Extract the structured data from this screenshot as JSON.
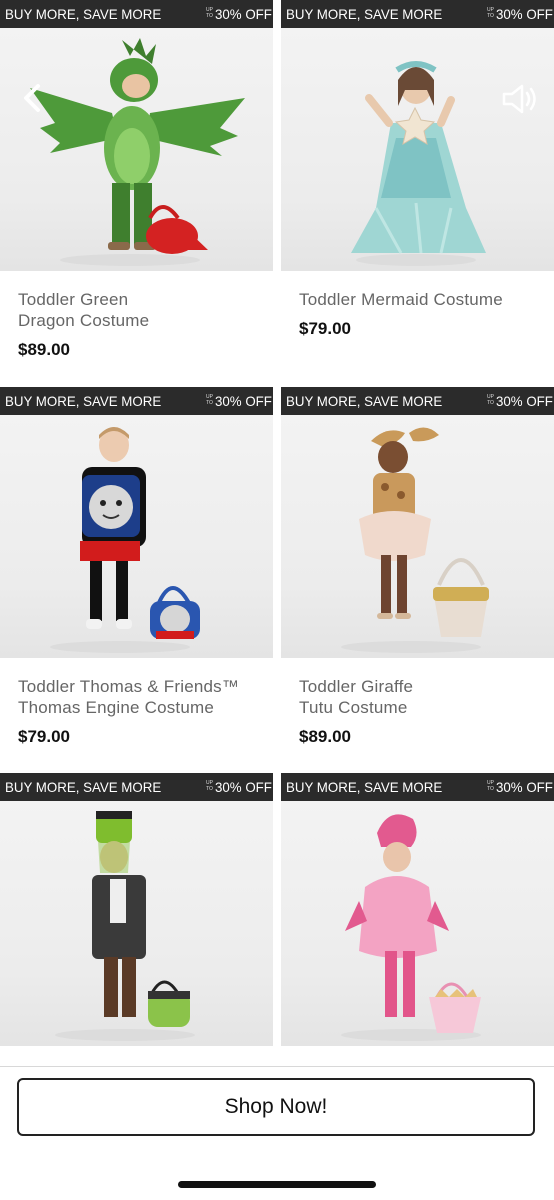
{
  "products": [
    {
      "promo": "BUY MORE, SAVE MORE",
      "upto": "UP\nTO",
      "discount": "30% OFF",
      "name": "Toddler Green\nDragon Costume",
      "price": "$89.00",
      "image_icon": "dragon-costume-photo"
    },
    {
      "promo": "BUY MORE, SAVE MORE",
      "upto": "UP\nTO",
      "discount": "30% OFF",
      "name": "Toddler Mermaid Costume",
      "price": "$79.00",
      "image_icon": "mermaid-costume-photo"
    },
    {
      "promo": "BUY MORE, SAVE MORE",
      "upto": "UP\nTO",
      "discount": "30% OFF",
      "name": "Toddler Thomas & Friends™\nThomas Engine Costume",
      "price": "$79.00",
      "image_icon": "thomas-costume-photo"
    },
    {
      "promo": "BUY MORE, SAVE MORE",
      "upto": "UP\nTO",
      "discount": "30% OFF",
      "name": "Toddler Giraffe\nTutu Costume",
      "price": "$89.00",
      "image_icon": "giraffe-costume-photo"
    },
    {
      "promo": "BUY MORE, SAVE MORE",
      "upto": "UP\nTO",
      "discount": "30% OFF",
      "name": "",
      "price": "",
      "image_icon": "frankenstein-costume-photo"
    },
    {
      "promo": "BUY MORE, SAVE MORE",
      "upto": "UP\nTO",
      "discount": "30% OFF",
      "name": "",
      "price": "",
      "image_icon": "flamingo-costume-photo"
    }
  ],
  "cta": {
    "label": "Shop Now!"
  },
  "icons": {
    "back": "chevron-left-icon",
    "sound": "speaker-icon"
  },
  "colors": {
    "banner_bg": "#2b2b2b",
    "price": "#111111",
    "name": "#666666"
  }
}
